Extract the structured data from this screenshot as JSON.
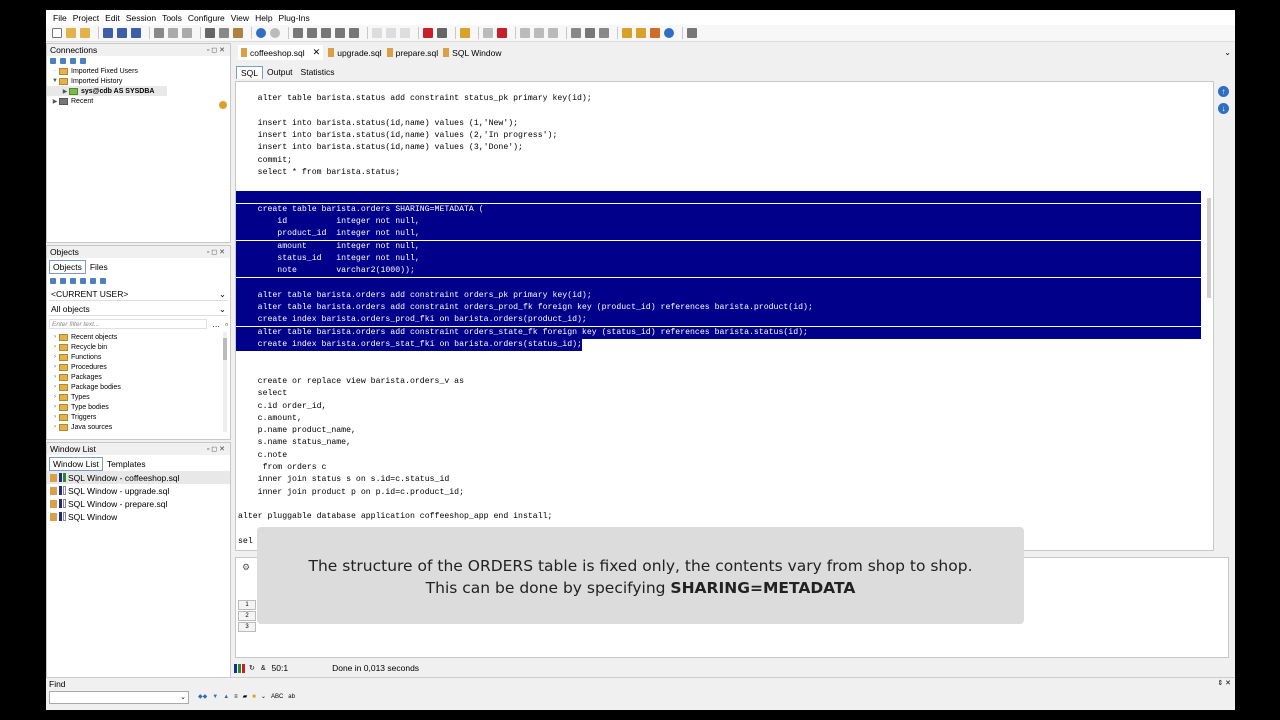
{
  "menu": [
    "File",
    "Project",
    "Edit",
    "Session",
    "Tools",
    "Configure",
    "View",
    "Help",
    "Plug-Ins"
  ],
  "connections": {
    "title": "Connections",
    "items": [
      "Imported Fixed Users",
      "Imported History",
      "sys@cdb AS SYSDBA",
      "Recent"
    ]
  },
  "objects": {
    "title": "Objects",
    "tabs": [
      "Objects",
      "Files"
    ],
    "user": "<CURRENT USER>",
    "scope": "All objects",
    "filter_placeholder": "Enter filter text...",
    "tree": [
      "Recent objects",
      "Recycle bin",
      "Functions",
      "Procedures",
      "Packages",
      "Package bodies",
      "Types",
      "Type bodies",
      "Triggers",
      "Java sources"
    ]
  },
  "windowlist": {
    "title": "Window List",
    "tabs": [
      "Window List",
      "Templates"
    ],
    "items": [
      "SQL Window - coffeeshop.sql",
      "SQL Window - upgrade.sql",
      "SQL Window - prepare.sql",
      "SQL Window"
    ]
  },
  "doc_tabs": [
    "coffeeshop.sql",
    "upgrade.sql",
    "prepare.sql",
    "SQL Window"
  ],
  "sub_tabs": [
    "SQL",
    "Output",
    "Statistics"
  ],
  "code": [
    {
      "text": "    alter table barista.status add constraint status_pk primary key(id);",
      "sel": false
    },
    {
      "text": "",
      "sel": false
    },
    {
      "text": "    insert into barista.status(id,name) values (1,'New');",
      "sel": false
    },
    {
      "text": "    insert into barista.status(id,name) values (2,'In progress');",
      "sel": false
    },
    {
      "text": "    insert into barista.status(id,name) values (3,'Done');",
      "sel": false
    },
    {
      "text": "    commit;",
      "sel": false
    },
    {
      "text": "    select * from barista.status;",
      "sel": false
    },
    {
      "text": "",
      "sel": false
    },
    {
      "text": "",
      "sel": true
    },
    {
      "text": "    create table barista.orders SHARING=METADATA (",
      "sel": true
    },
    {
      "text": "        id          integer not null,",
      "sel": true
    },
    {
      "text": "        product_id  integer not null,",
      "sel": true
    },
    {
      "text": "        amount      integer not null,",
      "sel": true
    },
    {
      "text": "        status_id   integer not null,",
      "sel": true
    },
    {
      "text": "        note        varchar2(1000));",
      "sel": true
    },
    {
      "text": "",
      "sel": true
    },
    {
      "text": "    alter table barista.orders add constraint orders_pk primary key(id);",
      "sel": true
    },
    {
      "text": "    alter table barista.orders add constraint orders_prod_fk foreign key (product_id) references barista.product(id);",
      "sel": true
    },
    {
      "text": "    create index barista.orders_prod_fki on barista.orders(product_id);",
      "sel": true
    },
    {
      "text": "    alter table barista.orders add constraint orders_state_fk foreign key (status_id) references barista.status(id);",
      "sel": true
    },
    {
      "text": "    create index barista.orders_stat_fki on barista.orders(status_id);",
      "sel": "partial"
    },
    {
      "text": "",
      "sel": false
    },
    {
      "text": "",
      "sel": false
    },
    {
      "text": "    create or replace view barista.orders_v as",
      "sel": false
    },
    {
      "text": "    select",
      "sel": false
    },
    {
      "text": "    c.id order_id,",
      "sel": false
    },
    {
      "text": "    c.amount,",
      "sel": false
    },
    {
      "text": "    p.name product_name,",
      "sel": false
    },
    {
      "text": "    s.name status_name,",
      "sel": false
    },
    {
      "text": "    c.note",
      "sel": false
    },
    {
      "text": "     from orders c",
      "sel": false
    },
    {
      "text": "    inner join status s on s.id=c.status_id",
      "sel": false
    },
    {
      "text": "    inner join product p on p.id=c.product_id;",
      "sel": false
    },
    {
      "text": "",
      "sel": false
    },
    {
      "text": "alter pluggable database application coffeeshop_app end install;",
      "sel": false
    },
    {
      "text": "",
      "sel": false
    },
    {
      "text": "sel",
      "sel": false
    }
  ],
  "grid_rows": [
    "1",
    "2",
    "3"
  ],
  "status": {
    "position": "50:1",
    "message": "Done in 0,013 seconds"
  },
  "find": {
    "label": "Find",
    "tools": "ABC"
  },
  "caption": {
    "line1": "The structure of the ORDERS table is fixed only, the contents vary from shop to shop.",
    "line2_prefix": "This can be done by specifying ",
    "line2_bold": "SHARING=METADATA"
  }
}
